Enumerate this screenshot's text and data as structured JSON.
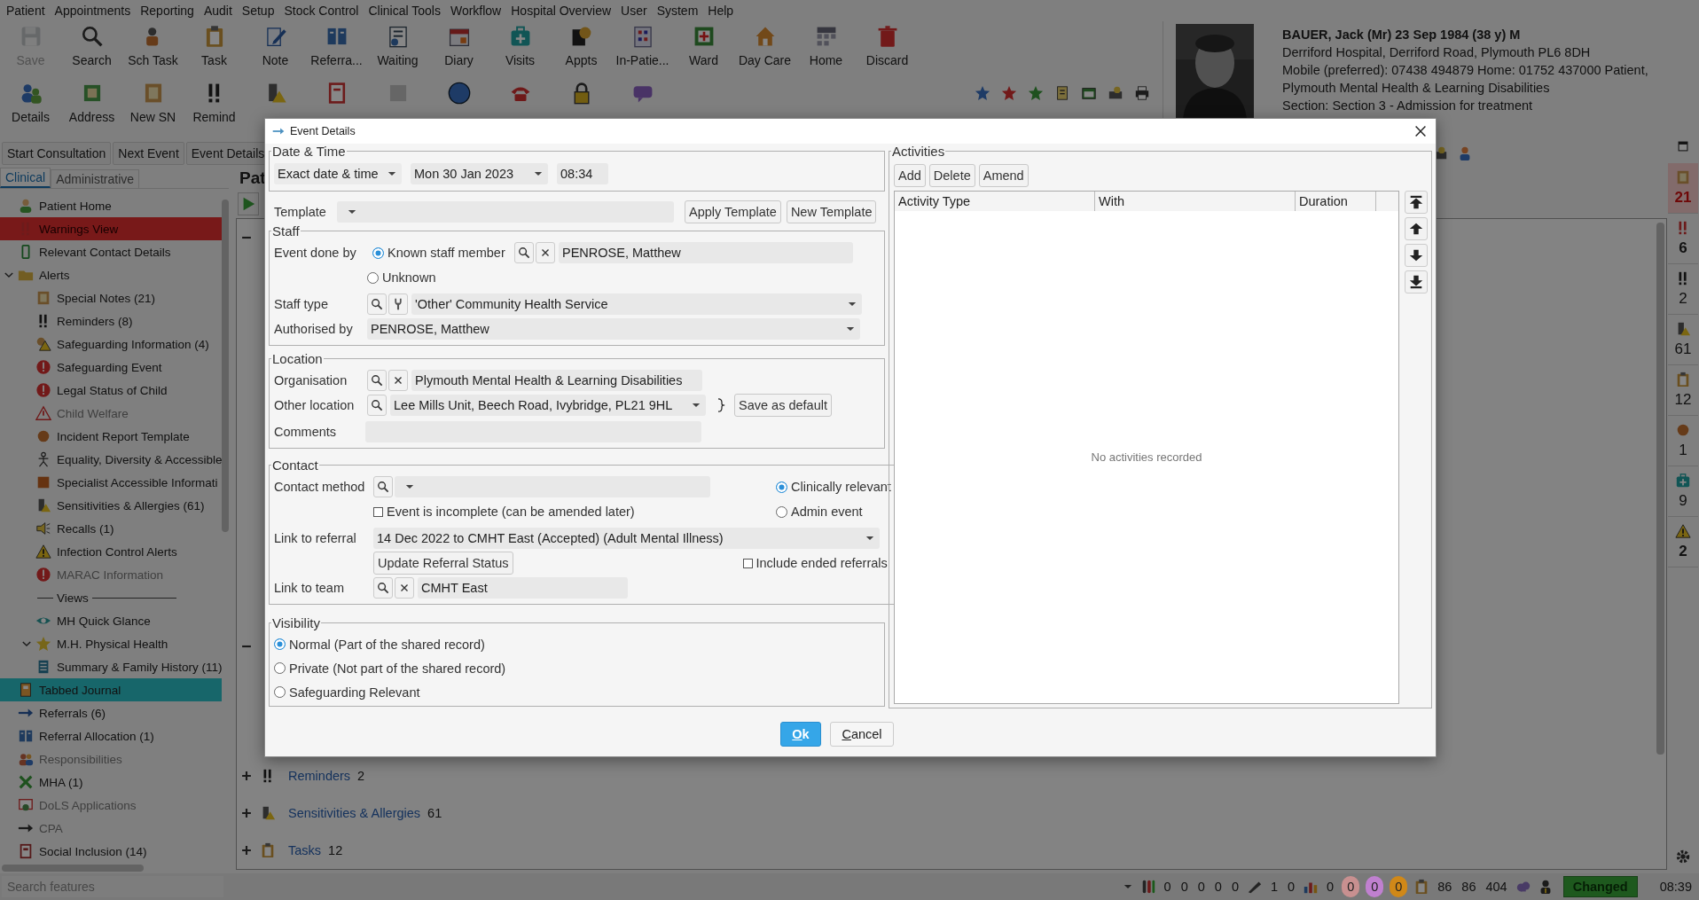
{
  "menu": [
    "Patient",
    "Appointments",
    "Reporting",
    "Audit",
    "Setup",
    "Stock Control",
    "Clinical Tools",
    "Workflow",
    "Hospital Overview",
    "User",
    "System",
    "Help"
  ],
  "toolbar": {
    "row_1": [
      {
        "label": "Save",
        "disabled": true
      },
      {
        "label": "Search",
        "disabled": false
      },
      {
        "label": "Sch Task",
        "disabled": false
      },
      {
        "label": "Task",
        "disabled": false
      },
      {
        "label": "Note",
        "disabled": false
      },
      {
        "label": "Referra...",
        "disabled": false
      },
      {
        "label": "Waiting",
        "disabled": false
      },
      {
        "label": "Diary",
        "disabled": false
      },
      {
        "label": "Visits",
        "disabled": false
      },
      {
        "label": "Appts",
        "disabled": false
      },
      {
        "label": "In-Patie...",
        "disabled": false
      },
      {
        "label": "Ward",
        "disabled": false
      },
      {
        "label": "Day Care",
        "disabled": false
      },
      {
        "label": "Home",
        "disabled": false
      },
      {
        "label": "Discard",
        "disabled": false
      }
    ],
    "row_2": [
      {
        "label": "Details",
        "disabled": false
      },
      {
        "label": "Address",
        "disabled": false
      },
      {
        "label": "New SN",
        "disabled": false
      },
      {
        "label": "Remind",
        "disabled": false
      },
      {
        "disabled": false
      },
      {
        "disabled": false
      },
      {
        "disabled": true
      },
      {
        "disabled": false
      },
      {
        "disabled": false
      },
      {
        "disabled": false
      },
      {
        "disabled": false
      }
    ]
  },
  "patient": {
    "name_line": "BAUER, Jack (Mr) 23 Sep 1984 (38 y) M",
    "address": "Derriford Hospital, Derriford Road, Plymouth PL6 8DH",
    "contact": "Mobile (preferred): 07438 494879 Home: 01752 437000   Patient, Plymouth Mental Health & Learning Disabilities",
    "section": "Section: Section 3 - Admission for treatment"
  },
  "event_buttons": [
    "Start Consultation",
    "Next Event",
    "Event Details"
  ],
  "sidebar": {
    "tabs": [
      {
        "label": "Clinical",
        "selected": true
      },
      {
        "label": "Administrative",
        "selected": false
      }
    ],
    "items": [
      {
        "label": "Patient Home",
        "kind": "link",
        "selected": false,
        "greyed": false
      },
      {
        "label": "Warnings View",
        "kind": "warning",
        "selected": false,
        "greyed": false
      },
      {
        "label": "Relevant Contact Details",
        "kind": "link",
        "selected": false,
        "greyed": false
      },
      {
        "label": "Alerts",
        "kind": "link",
        "selected": false,
        "greyed": false,
        "expanded": true,
        "children": [
          {
            "label": "Special Notes (21)",
            "kind": "link",
            "selected": false,
            "greyed": false
          },
          {
            "label": "Reminders (8)",
            "kind": "link",
            "selected": false,
            "greyed": false
          },
          {
            "label": "Safeguarding Information (4)",
            "kind": "link",
            "selected": false,
            "greyed": false
          },
          {
            "label": "Safeguarding Event",
            "kind": "link",
            "selected": false,
            "greyed": false
          },
          {
            "label": "Legal Status of Child",
            "kind": "link",
            "selected": false,
            "greyed": false
          },
          {
            "label": "Child Welfare",
            "kind": "link",
            "selected": false,
            "greyed": true
          },
          {
            "label": "Incident Report Template",
            "kind": "link",
            "selected": false,
            "greyed": false
          },
          {
            "label": "Equality, Diversity & Accessible",
            "kind": "link",
            "selected": false,
            "greyed": false
          },
          {
            "label": "Specialist Accessible Informati",
            "kind": "link",
            "selected": false,
            "greyed": false
          },
          {
            "label": "Sensitivities & Allergies (61)",
            "kind": "link",
            "selected": false,
            "greyed": false
          },
          {
            "label": "Recalls (1)",
            "kind": "link",
            "selected": false,
            "greyed": false
          },
          {
            "label": "Infection Control Alerts",
            "kind": "link",
            "selected": false,
            "greyed": false
          },
          {
            "label": "MARAC Information",
            "kind": "link",
            "selected": false,
            "greyed": true
          },
          {
            "label": "Views",
            "kind": "separator"
          },
          {
            "label": "MH Quick Glance",
            "kind": "link",
            "selected": false,
            "greyed": false
          },
          {
            "label": "M.H. Physical Health",
            "kind": "link",
            "selected": false,
            "greyed": false,
            "expanded": true,
            "children": [
              {
                "label": "Summary & Family History (11)",
                "kind": "link",
                "selected": false,
                "greyed": false
              }
            ]
          }
        ]
      },
      {
        "label": "Tabbed Journal",
        "kind": "link",
        "selected": true,
        "greyed": false
      },
      {
        "label": "Referrals (6)",
        "kind": "link",
        "selected": false,
        "greyed": false
      },
      {
        "label": "Referral Allocation (1)",
        "kind": "link",
        "selected": false,
        "greyed": false
      },
      {
        "label": "Responsibilities",
        "kind": "link",
        "selected": false,
        "greyed": true
      },
      {
        "label": "MHA (1)",
        "kind": "link",
        "selected": false,
        "greyed": false
      },
      {
        "label": "DoLS Applications",
        "kind": "link",
        "selected": false,
        "greyed": true
      },
      {
        "label": "CPA",
        "kind": "link",
        "selected": false,
        "greyed": true
      },
      {
        "label": "Social Inclusion (14)",
        "kind": "link",
        "selected": false,
        "greyed": false
      }
    ]
  },
  "content": {
    "title": "Pat",
    "sections": [
      {
        "label": "Reminders",
        "count": "2"
      },
      {
        "label": "Sensitivities & Allergies",
        "count": "61"
      },
      {
        "label": "Tasks",
        "count": "12"
      }
    ]
  },
  "right_strip": [
    {
      "count": "21",
      "kind": "alert"
    },
    {
      "count": "6",
      "kind": "bold"
    },
    {
      "count": "2",
      "kind": "plain"
    },
    {
      "count": "61",
      "kind": "plain"
    },
    {
      "count": "12",
      "kind": "plain"
    },
    {
      "count": "1",
      "kind": "plain"
    },
    {
      "count": "9",
      "kind": "plain"
    },
    {
      "count": "2",
      "kind": "bold"
    }
  ],
  "status_bar": {
    "search": {
      "placeholder": "Search features"
    },
    "groups": [
      {
        "values": [
          "0",
          "0",
          "0",
          "0",
          "0"
        ]
      },
      {
        "values": [
          "1",
          "0"
        ]
      },
      {
        "values": [
          "0"
        ]
      }
    ],
    "badges": [
      {
        "value": "0",
        "color": "#c89090"
      },
      {
        "value": "0",
        "color": "#c080d0"
      },
      {
        "value": "0",
        "color": "#d08818"
      }
    ],
    "totals": [
      "86",
      "86",
      "404"
    ],
    "state": "Changed",
    "clock": "08:39"
  },
  "dialog": {
    "title": "Event Details",
    "date_time": {
      "legend": "Date & Time",
      "mode": "Exact date & time",
      "date": "Mon 30 Jan 2023",
      "time": "08:34"
    },
    "template": {
      "label": "Template",
      "apply": "Apply Template",
      "new": "New Template"
    },
    "staff": {
      "legend": "Staff",
      "event_done_by": {
        "label": "Event done by",
        "options": [
          {
            "label": "Known staff member",
            "selected": true
          },
          {
            "label": "Unknown",
            "selected": false
          }
        ],
        "value": "PENROSE, Matthew"
      },
      "staff_type": {
        "label": "Staff type",
        "value": "'Other' Community Health Service"
      },
      "authorised_by": {
        "label": "Authorised by",
        "value": "PENROSE, Matthew"
      }
    },
    "location": {
      "legend": "Location",
      "organisation": {
        "label": "Organisation",
        "value": "Plymouth Mental Health & Learning Disabilities"
      },
      "other_location": {
        "label": "Other location",
        "value": "Lee Mills Unit, Beech Road, Ivybridge, PL21 9HL"
      },
      "save_default": "Save as default",
      "comments": {
        "label": "Comments"
      }
    },
    "contact": {
      "legend": "Contact",
      "contact_method": {
        "label": "Contact method"
      },
      "relevance": [
        {
          "label": "Clinically relevant",
          "selected": true
        },
        {
          "label": "Admin event",
          "selected": false
        }
      ],
      "incomplete": {
        "label": "Event is incomplete (can be amended later)",
        "checked": false
      },
      "link_to_referral": {
        "label": "Link to referral",
        "value": "14 Dec 2022 to CMHT East (Accepted)  (Adult Mental Illness)"
      },
      "update_referral": "Update Referral Status",
      "include_ended": {
        "label": "Include ended referrals",
        "checked": false
      },
      "link_to_team": {
        "label": "Link to team",
        "value": "CMHT East"
      }
    },
    "visibility": {
      "legend": "Visibility",
      "options": [
        {
          "label": "Normal (Part of the shared record)",
          "selected": true
        },
        {
          "label": "Private (Not part of the shared record)",
          "selected": false
        },
        {
          "label": "Safeguarding Relevant",
          "selected": false
        }
      ]
    },
    "activities": {
      "legend": "Activities",
      "buttons": [
        "Add",
        "Delete",
        "Amend"
      ],
      "columns": [
        "Activity Type",
        "With",
        "Duration"
      ],
      "empty": "No activities recorded"
    },
    "ok": "Ok",
    "cancel": "Cancel"
  }
}
